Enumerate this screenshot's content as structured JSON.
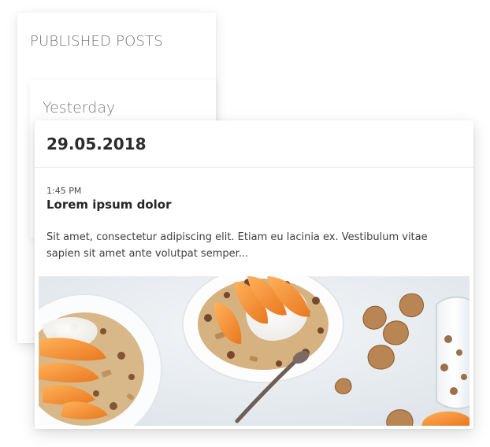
{
  "published": {
    "title": "PUBLISHED POSTS",
    "group_label": "Yesterday"
  },
  "post": {
    "date": "29.05.2018",
    "time": "1:45 PM",
    "title": "Lorem ipsum dolor",
    "excerpt": "Sit amet, consectetur adipiscing elit. Etiam eu lacinia ex. Vestibulum vitae sapien sit amet ante volutpat semper...",
    "image_subject": "granola bowls with yogurt, peaches and walnuts"
  },
  "colors": {
    "background": "#ffffff",
    "panel": "#ffffff",
    "heading_text": "#6f6f6f",
    "date_text": "#2b2b2b",
    "body_text": "#3f3f3f",
    "peach": "#f39a3b",
    "yogurt": "#f7f5f1",
    "bowl": "#ffffff",
    "walnut": "#b98552"
  }
}
